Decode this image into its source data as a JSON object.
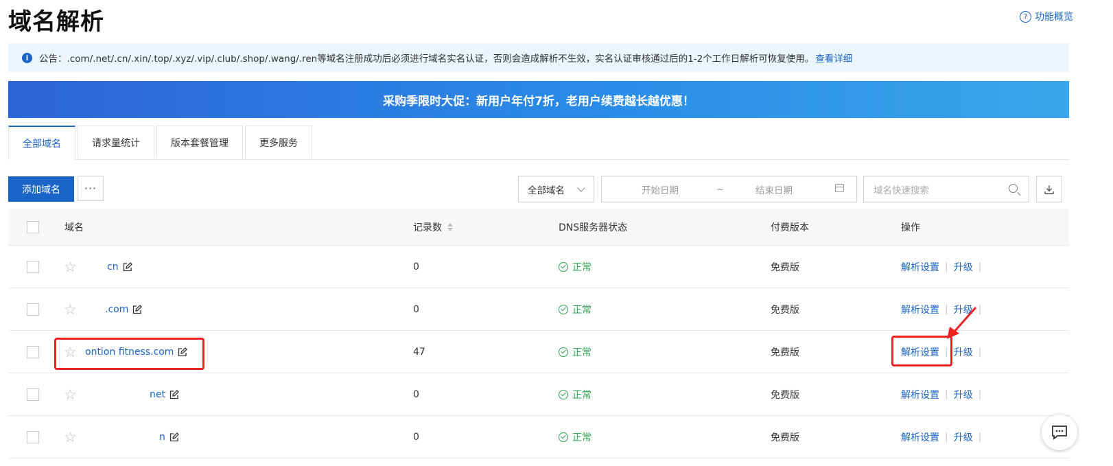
{
  "header": {
    "title": "域名解析",
    "help_label": "功能概览"
  },
  "notice": {
    "text": "公告：.com/.net/.cn/.xin/.top/.xyz/.vip/.club/.shop/.wang/.ren等域名注册成功后必须进行域名实名认证，否则会造成解析不生效，实名认证审核通过后的1-2个工作日解析可恢复使用。",
    "link": "查看详细"
  },
  "promo": {
    "text": "采购季限时大促：新用户年付7折，老用户续费越长越优惠！"
  },
  "tabs": [
    {
      "label": "全部域名",
      "active": true
    },
    {
      "label": "请求量统计",
      "active": false
    },
    {
      "label": "版本套餐管理",
      "active": false
    },
    {
      "label": "更多服务",
      "active": false
    }
  ],
  "toolbar": {
    "add_label": "添加域名",
    "more_label": "···",
    "filter_value": "全部域名",
    "date_start_placeholder": "开始日期",
    "date_separator": "~",
    "date_end_placeholder": "结束日期",
    "search_placeholder": "域名快速搜索"
  },
  "table": {
    "headers": {
      "domain": "域名",
      "records": "记录数",
      "dns_status": "DNS服务器状态",
      "plan": "付费版本",
      "actions": "操作"
    },
    "rows": [
      {
        "domain": "cn",
        "records": "0",
        "status": "正常",
        "plan": "免费版",
        "action_resolve": "解析设置",
        "action_upgrade": "升级"
      },
      {
        "domain": ".com",
        "records": "0",
        "status": "正常",
        "plan": "免费版",
        "action_resolve": "解析设置",
        "action_upgrade": "升级"
      },
      {
        "domain": "ontion  fitness.com",
        "records": "47",
        "status": "正常",
        "plan": "免费版",
        "action_resolve": "解析设置",
        "action_upgrade": "升级"
      },
      {
        "domain": "net",
        "records": "0",
        "status": "正常",
        "plan": "免费版",
        "action_resolve": "解析设置",
        "action_upgrade": "升级"
      },
      {
        "domain": "n",
        "records": "0",
        "status": "正常",
        "plan": "免费版",
        "action_resolve": "解析设置",
        "action_upgrade": "升级"
      }
    ]
  },
  "colors": {
    "accent": "#1a64c8",
    "success": "#2ea44f",
    "annotation": "#ee2222"
  }
}
